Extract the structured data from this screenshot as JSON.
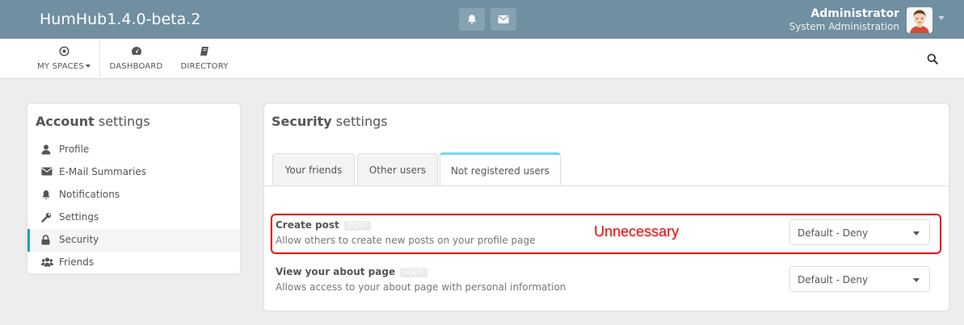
{
  "header": {
    "brand": "HumHub1.4.0-beta.2",
    "user_name": "Administrator",
    "user_subtitle": "System Administration",
    "icons": [
      "bell-icon",
      "envelope-icon"
    ]
  },
  "nav": {
    "items": [
      {
        "label": "MY SPACES",
        "icon": "dot-circle-icon",
        "has_caret": true
      },
      {
        "label": "DASHBOARD",
        "icon": "dashboard-icon"
      },
      {
        "label": "DIRECTORY",
        "icon": "book-icon"
      }
    ],
    "search_icon": "search-icon"
  },
  "account": {
    "title_bold": "Account",
    "title_rest": " settings",
    "items": [
      {
        "label": "Profile",
        "icon": "user-icon"
      },
      {
        "label": "E-Mail Summaries",
        "icon": "envelope-icon"
      },
      {
        "label": "Notifications",
        "icon": "bell-icon"
      },
      {
        "label": "Settings",
        "icon": "wrench-icon"
      },
      {
        "label": "Security",
        "icon": "lock-icon",
        "active": true
      },
      {
        "label": "Friends",
        "icon": "users-icon"
      }
    ]
  },
  "security": {
    "title_bold": "Security",
    "title_rest": " settings",
    "tabs": [
      {
        "label": "Your friends"
      },
      {
        "label": "Other users"
      },
      {
        "label": "Not registered users",
        "active": true
      }
    ],
    "rows": [
      {
        "title": "Create post",
        "badge": "POST",
        "description": "Allow others to create new posts on your profile page",
        "value": "Default - Deny"
      },
      {
        "title": "View your about page",
        "badge": "USER",
        "description": "Allows access to your about page with personal information",
        "value": "Default - Deny"
      }
    ]
  },
  "annotation": {
    "text": "Unnecessary",
    "color": "#e0191b"
  },
  "colors": {
    "topbar": "#708fa0",
    "accent": "#21a1b3",
    "tab_active_border": "#6fdbe8"
  }
}
